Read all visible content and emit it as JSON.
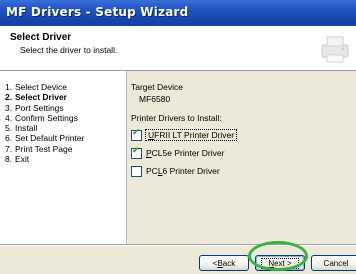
{
  "window": {
    "title": "MF Drivers - Setup Wizard"
  },
  "header": {
    "title": "Select Driver",
    "subtitle": "Select the driver to install."
  },
  "steps": [
    {
      "num": "1.",
      "label": "Select Device",
      "current": false
    },
    {
      "num": "2.",
      "label": "Select Driver",
      "current": true
    },
    {
      "num": "3.",
      "label": "Port Settings",
      "current": false
    },
    {
      "num": "4.",
      "label": "Confirm Settings",
      "current": false
    },
    {
      "num": "5.",
      "label": "Install",
      "current": false
    },
    {
      "num": "6.",
      "label": "Set Default Printer",
      "current": false
    },
    {
      "num": "7.",
      "label": "Print Test Page",
      "current": false
    },
    {
      "num": "8.",
      "label": "Exit",
      "current": false
    }
  ],
  "content": {
    "target_label": "Target Device",
    "target_value": "MF6580",
    "drivers_label": "Printer Drivers to Install:",
    "drivers": [
      {
        "mnemonic": "U",
        "rest": "FRII LT Printer Driver",
        "checked": true,
        "focused": true
      },
      {
        "mnemonic": "P",
        "rest": "CL5e Printer Driver",
        "checked": true,
        "focused": false
      },
      {
        "pre": "PC",
        "mnemonic": "L",
        "rest": "6 Printer Driver",
        "checked": false,
        "focused": false
      }
    ]
  },
  "buttons": {
    "back": {
      "pre": "< ",
      "mnemonic": "B",
      "rest": "ack"
    },
    "next": {
      "mnemonic": "N",
      "rest": "ext >"
    },
    "cancel": "Cancel"
  },
  "colors": {
    "titlebar": "#2457c7",
    "highlight_ring": "#3cb33c",
    "check_mark": "#21a121"
  },
  "icons": {
    "header": "printer-setup-icon",
    "check": "check-mark-icon"
  }
}
